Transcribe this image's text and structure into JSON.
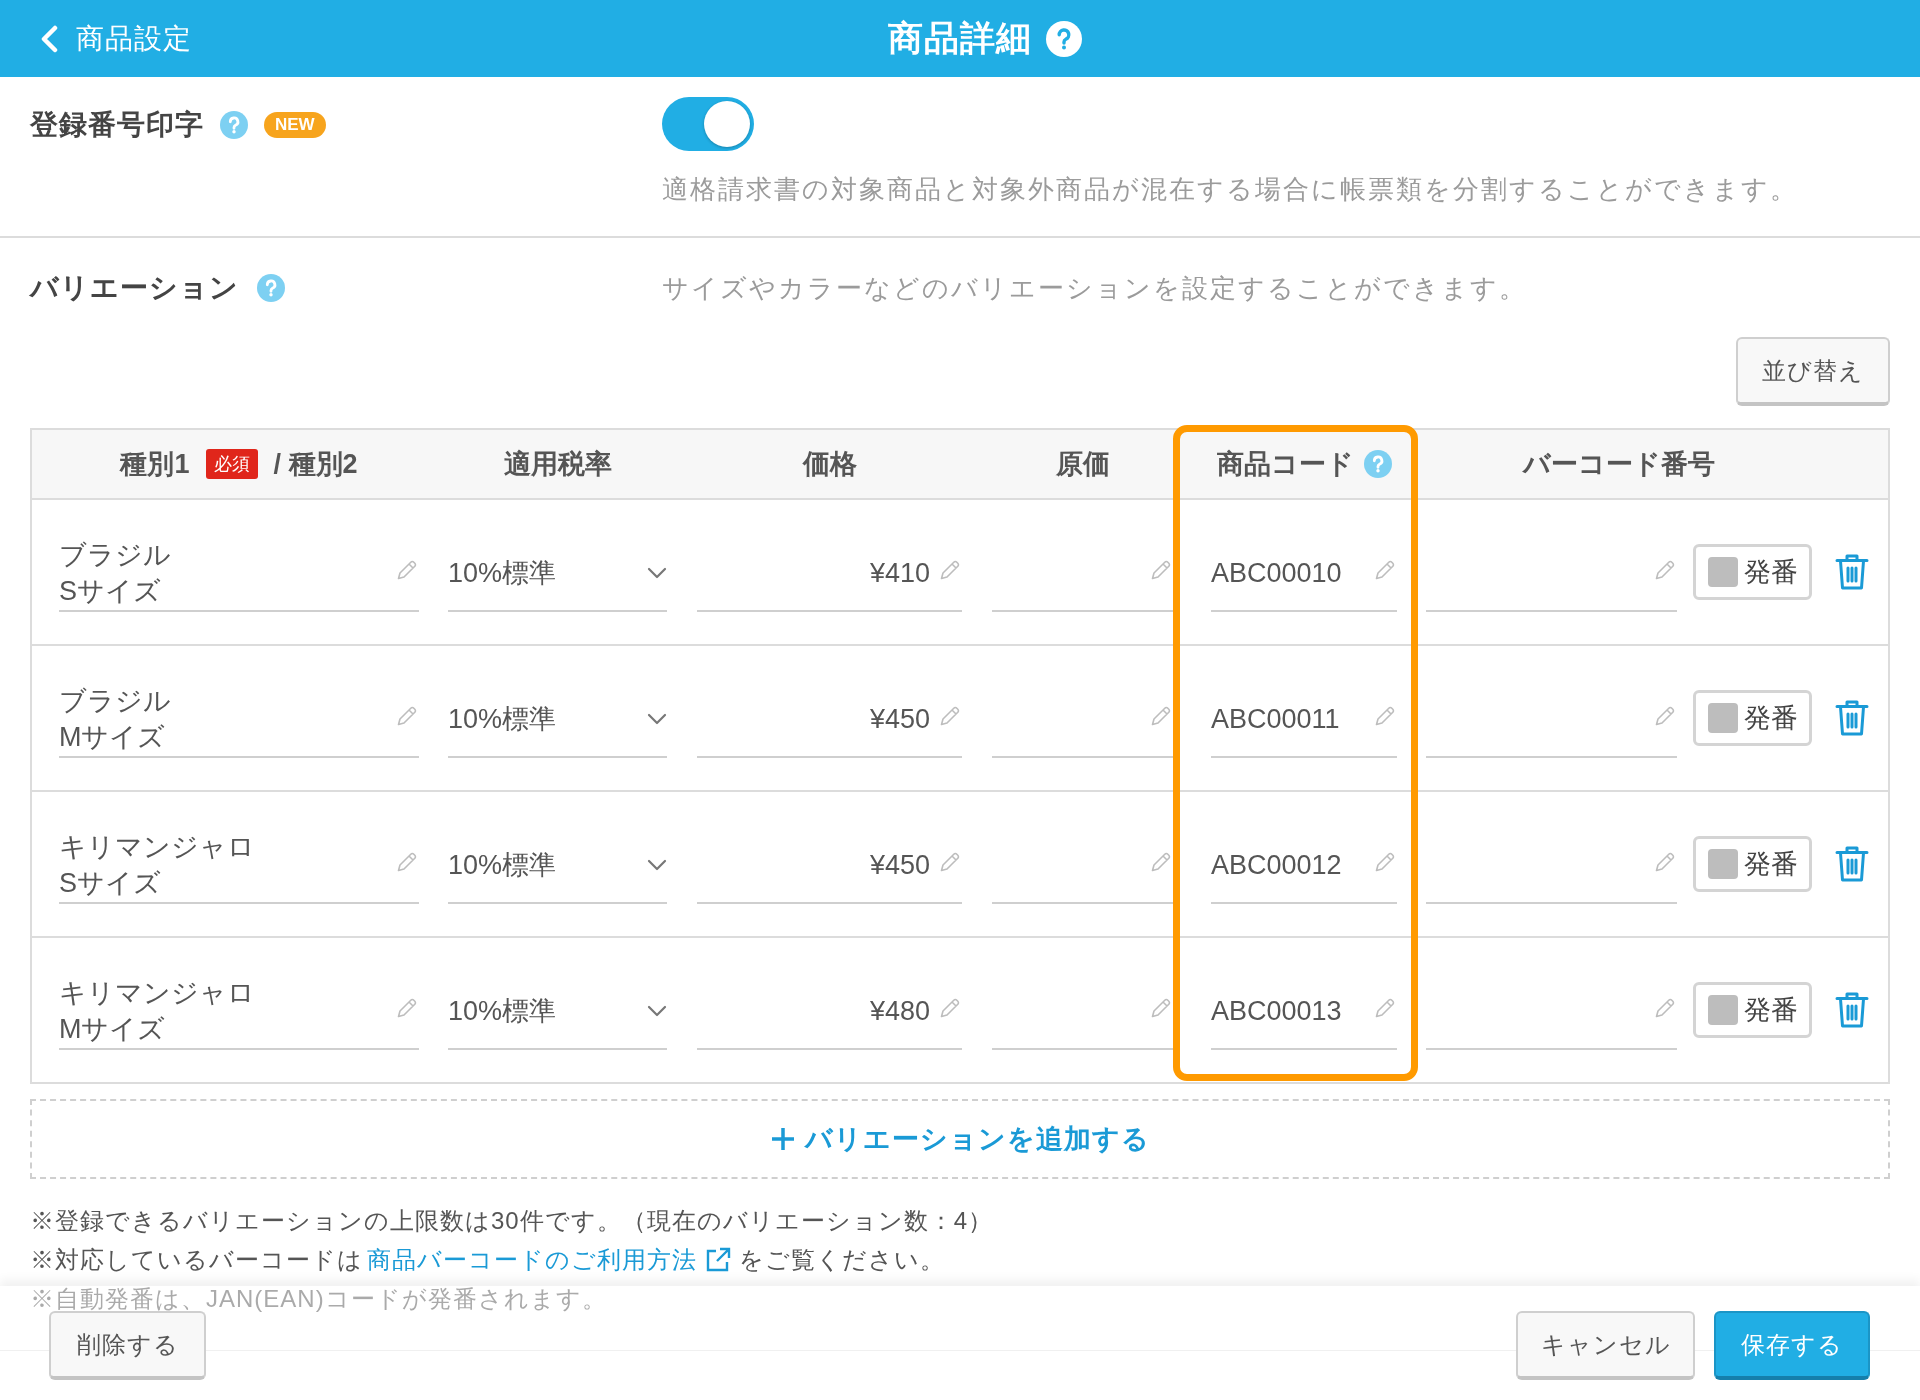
{
  "header": {
    "back_label": "商品設定",
    "title": "商品詳細",
    "help": true
  },
  "invoice_print": {
    "label": "登録番号印字",
    "help": true,
    "badge": "NEW",
    "toggle": {
      "on": true
    },
    "description": "適格請求書の対象商品と対象外商品が混在する場合に帳票類を分割することができます。"
  },
  "variations": {
    "label": "バリエーション",
    "help": true,
    "description": "サイズやカラーなどのバリエーションを設定することができます。",
    "sort_button": "並び替え",
    "table": {
      "columns": [
        {
          "label": "種別1",
          "badge": "必須",
          "suffix": "/ 種別2",
          "help": false,
          "highlighted": false
        },
        {
          "label": "適用税率",
          "help": false,
          "highlighted": false
        },
        {
          "label": "価格",
          "help": false,
          "highlighted": false
        },
        {
          "label": "原価",
          "help": false,
          "highlighted": false
        },
        {
          "label": "商品コード",
          "help": true,
          "highlighted": true
        },
        {
          "label": "バーコード番号",
          "help": false,
          "highlighted": false
        }
      ],
      "rows": [
        {
          "type1": "ブラジル",
          "type2": "Sサイズ",
          "tax_rate": "10%標準",
          "price": "¥410",
          "product_code": "ABC00010",
          "auto_number": {
            "label": "発番",
            "checked": false
          }
        },
        {
          "type1": "ブラジル",
          "type2": "Mサイズ",
          "tax_rate": "10%標準",
          "price": "¥450",
          "product_code": "ABC00011",
          "auto_number": {
            "label": "発番",
            "checked": false
          }
        },
        {
          "type1": "キリマンジャロ",
          "type2": "Sサイズ",
          "tax_rate": "10%標準",
          "price": "¥450",
          "product_code": "ABC00012",
          "auto_number": {
            "label": "発番",
            "checked": false
          }
        },
        {
          "type1": "キリマンジャロ",
          "type2": "Mサイズ",
          "tax_rate": "10%標準",
          "price": "¥480",
          "product_code": "ABC00013",
          "auto_number": {
            "label": "発番",
            "checked": false
          }
        }
      ]
    },
    "add_button": "バリエーションを追加する",
    "notes": [
      {
        "text": "※登録できるバリエーションの上限数は30件です。（現在のバリエーション数：4）"
      },
      {
        "text": "※対応しているバーコードは",
        "link": "商品バーコードのご利用方法",
        "after": "をご覧ください。"
      },
      {
        "text": "※自動発番は、JAN(EAN)コードが発番されます。"
      }
    ]
  },
  "footer": {
    "left_buttons": [
      {
        "label": "削除する",
        "kind": "secondary"
      }
    ],
    "right_buttons": [
      {
        "label": "キャンセル",
        "kind": "secondary"
      },
      {
        "label": "保存する",
        "kind": "primary"
      }
    ]
  }
}
